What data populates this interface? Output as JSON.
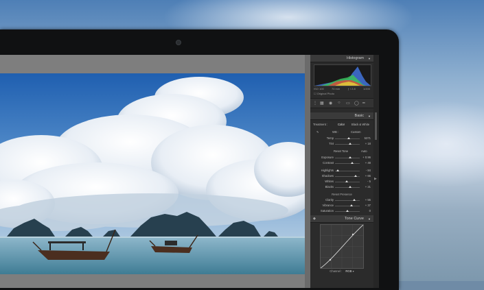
{
  "panel": {
    "histogram_title": "Histogram",
    "histogram_readout": {
      "iso": "ISO 100",
      "focal": "70 mm",
      "aperture": "ƒ / 2.8",
      "shutter": "1/200"
    },
    "original_photo": "Original Photo",
    "basic_title": "Basic",
    "treatment_label": "Treatment :",
    "treatment_color": "Color",
    "treatment_bw": "Black & White",
    "wb_label": "WB :",
    "wb_value": "Custom",
    "temp": {
      "label": "Temp",
      "value": "5371",
      "level": 0.55
    },
    "tint": {
      "label": "Tint",
      "value": "+ 18",
      "level": 0.6
    },
    "tone_header": {
      "reset": "Reset Tone",
      "auto": "Auto"
    },
    "exposure": {
      "label": "Exposure",
      "value": "+ 0.96",
      "level": 0.62
    },
    "contrast": {
      "label": "Contrast",
      "value": "+ 48",
      "level": 0.7
    },
    "highlights": {
      "label": "Highlights",
      "value": "- 84",
      "level": 0.1
    },
    "shadows": {
      "label": "Shadows",
      "value": "+ 66",
      "level": 0.82
    },
    "whites": {
      "label": "Whites",
      "value": "- 5",
      "level": 0.48
    },
    "blacks": {
      "label": "Blacks",
      "value": "+ 21",
      "level": 0.6
    },
    "presence_header": "Reset Presence",
    "clarity": {
      "label": "Clarity",
      "value": "+ 55",
      "level": 0.77
    },
    "vibrance": {
      "label": "Vibrance",
      "value": "+ 37",
      "level": 0.68
    },
    "saturation": {
      "label": "Saturation",
      "value": "0",
      "level": 0.5
    },
    "tone_curve_title": "Tone Curve",
    "channel_label": "Channel :",
    "channel_value": "RGB"
  },
  "colors": {
    "panel_bg": "#2b2b2b",
    "header_bg": "#3a3a3a",
    "text": "#bdbdbd"
  }
}
